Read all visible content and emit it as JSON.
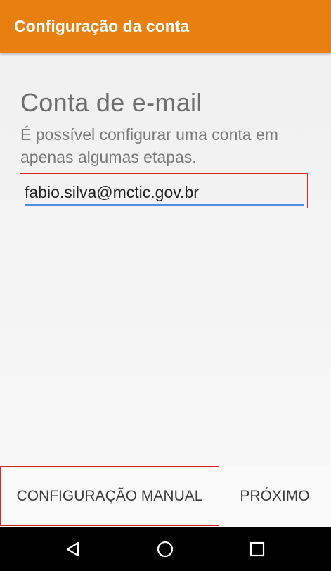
{
  "app_bar": {
    "title": "Configuração da conta",
    "color": "#e8800f"
  },
  "content": {
    "heading": "Conta de e-mail",
    "subtitle": "É possível configurar uma conta em apenas algumas etapas."
  },
  "email_field": {
    "value": "fabio.silva@mctic.gov.br",
    "underline_color": "#4d8fe3"
  },
  "actions": {
    "manual_label": "CONFIGURAÇÃO MANUAL",
    "next_label": "PRÓXIMO"
  },
  "highlight_color": "#d9262b",
  "nav_bar": {
    "back_icon": "back-triangle-icon",
    "home_icon": "home-circle-icon",
    "recents_icon": "recents-square-icon"
  }
}
